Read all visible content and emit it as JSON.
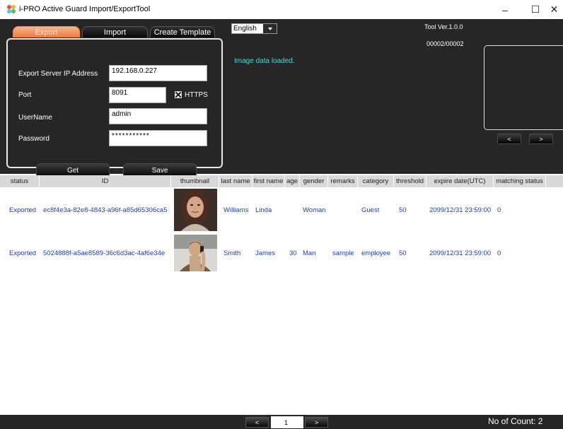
{
  "window": {
    "title": "i-PRO Active Guard Import/ExportTool",
    "minimize_glyph": "–",
    "maximize_glyph": "☐",
    "close_glyph": "✕"
  },
  "tabs": [
    {
      "label": "Export",
      "active": true
    },
    {
      "label": "Import",
      "active": false
    },
    {
      "label": "Create Template",
      "active": false
    }
  ],
  "form": {
    "ip_label": "Export Server IP Address",
    "ip_value": "192.168.0.227",
    "port_label": "Port",
    "port_value": "8091",
    "https_label": "HTTPS",
    "https_checked": true,
    "user_label": "UserName",
    "user_value": "admin",
    "password_label": "Password",
    "password_value": "***********",
    "get_label": "Get",
    "save_label": "Save"
  },
  "language": {
    "selected": "English"
  },
  "status_message": "Image data loaded.",
  "tool_version": "Tool Ver.1.0.0",
  "record_counter": "00002/00002",
  "preview_nav": {
    "prev": "<",
    "next": ">"
  },
  "table": {
    "columns": [
      "status",
      "ID",
      "thumbnail",
      "last name",
      "first name",
      "age",
      "gender",
      "remarks",
      "category",
      "threshold",
      "expire date(UTC)",
      "matching status"
    ],
    "rows": [
      {
        "status": "Exported",
        "id": "ec8f4e3a-82e8-4843-a96f-a85d65306ca5",
        "thumbnail": "woman-portrait",
        "last_name": "Williams",
        "first_name": "Linda",
        "age": "",
        "gender": "Woman",
        "remarks": "",
        "category": "Guest",
        "threshold": "50",
        "expire": "2099/12/31 23:59:00",
        "matching": "0"
      },
      {
        "status": "Exported",
        "id": "5024888f-a5ae8589-36c6d3ac-4af6e34e",
        "thumbnail": "man-on-phone",
        "last_name": "Smith",
        "first_name": "James",
        "age": "30",
        "gender": "Man",
        "remarks": "sample",
        "category": "employee",
        "threshold": "50",
        "expire": "2099/12/31 23:59:00",
        "matching": "0"
      }
    ]
  },
  "pager": {
    "prev": "<",
    "page": "1",
    "next": ">"
  },
  "count_label": "No of Count: 2",
  "colors": {
    "panel": "#262626",
    "accent_tab": "#ef7a3c",
    "status_text": "#4dd8d8",
    "cell_text": "#1c3fa8"
  }
}
